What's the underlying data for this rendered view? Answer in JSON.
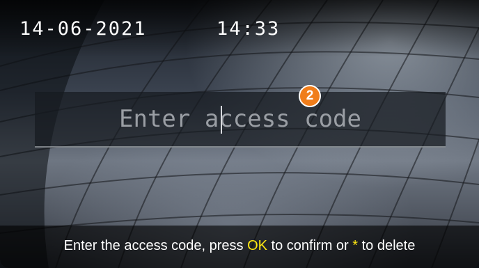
{
  "status": {
    "date": "14-06-2021",
    "time": "14:33"
  },
  "code_entry": {
    "placeholder": "Enter access code",
    "value": ""
  },
  "callout": {
    "number": "2",
    "color": "#f07d1a"
  },
  "instruction": {
    "part1": "Enter the access code, press ",
    "ok_key": "OK",
    "part2": " to confirm or ",
    "star_key": "*",
    "part3": " to delete",
    "highlight_color": "#ffe812"
  }
}
